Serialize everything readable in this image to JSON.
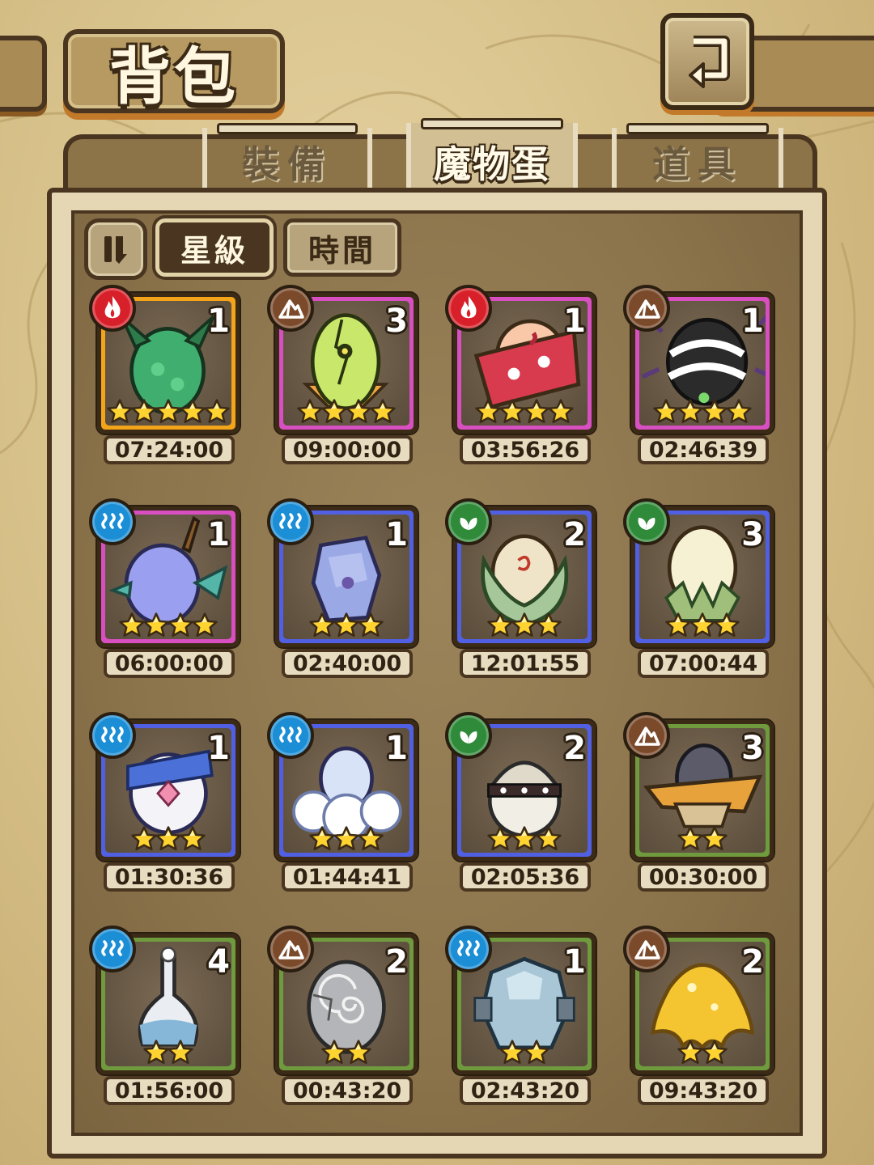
{
  "header": {
    "title": "背包",
    "back_icon": "return-arrow-icon"
  },
  "tabs": [
    {
      "label": "裝備",
      "active": false
    },
    {
      "label": "魔物蛋",
      "active": true
    },
    {
      "label": "道具",
      "active": false
    }
  ],
  "sort": {
    "toggle_icon": "sort-toggle-icon",
    "star_label": "星級",
    "time_label": "時間",
    "active": "星級"
  },
  "colors": {
    "frame_gold": "#f3a418",
    "frame_pink": "#d74fc1",
    "frame_blue": "#5160e3",
    "frame_green": "#6f9a3d",
    "fire": "#d8202a",
    "earth": "#7a4a2b",
    "water": "#1b8ed6",
    "wind": "#2f8a3a"
  },
  "eggs": [
    {
      "element": "fire",
      "element_icon": "fire-element-icon",
      "count": "1",
      "stars": 5,
      "rarity": "gold",
      "timer": "07:24:00",
      "art": "green-dragon-egg"
    },
    {
      "element": "earth",
      "element_icon": "earth-element-icon",
      "count": "3",
      "stars": 4,
      "rarity": "pink",
      "timer": "09:00:00",
      "art": "cracked-eye-egg"
    },
    {
      "element": "fire",
      "element_icon": "fire-element-icon",
      "count": "1",
      "stars": 4,
      "rarity": "pink",
      "timer": "03:56:26",
      "art": "kimono-egg"
    },
    {
      "element": "earth",
      "element_icon": "earth-element-icon",
      "count": "1",
      "stars": 4,
      "rarity": "pink",
      "timer": "02:46:39",
      "art": "spider-egg"
    },
    {
      "element": "water",
      "element_icon": "water-element-icon",
      "count": "1",
      "stars": 4,
      "rarity": "pink",
      "timer": "06:00:00",
      "art": "horned-fin-egg"
    },
    {
      "element": "water",
      "element_icon": "water-element-icon",
      "count": "1",
      "stars": 3,
      "rarity": "blue",
      "timer": "02:40:00",
      "art": "crystal-egg"
    },
    {
      "element": "wind",
      "element_icon": "wind-element-icon",
      "count": "2",
      "stars": 3,
      "rarity": "blue",
      "timer": "12:01:55",
      "art": "leaf-wrapped-egg"
    },
    {
      "element": "wind",
      "element_icon": "wind-element-icon",
      "count": "3",
      "stars": 3,
      "rarity": "blue",
      "timer": "07:00:44",
      "art": "flower-bud-egg"
    },
    {
      "element": "water",
      "element_icon": "water-element-icon",
      "count": "1",
      "stars": 3,
      "rarity": "blue",
      "timer": "01:30:36",
      "art": "sailor-egg"
    },
    {
      "element": "water",
      "element_icon": "water-element-icon",
      "count": "1",
      "stars": 3,
      "rarity": "blue",
      "timer": "01:44:41",
      "art": "cloud-egg"
    },
    {
      "element": "wind",
      "element_icon": "wind-element-icon",
      "count": "2",
      "stars": 3,
      "rarity": "blue",
      "timer": "02:05:36",
      "art": "helmet-egg"
    },
    {
      "element": "earth",
      "element_icon": "earth-element-icon",
      "count": "3",
      "stars": 2,
      "rarity": "green",
      "timer": "00:30:00",
      "art": "hat-egg"
    },
    {
      "element": "water",
      "element_icon": "water-element-icon",
      "count": "4",
      "stars": 2,
      "rarity": "green",
      "timer": "01:56:00",
      "art": "flask-egg"
    },
    {
      "element": "earth",
      "element_icon": "earth-element-icon",
      "count": "2",
      "stars": 2,
      "rarity": "green",
      "timer": "00:43:20",
      "art": "stone-spiral-egg"
    },
    {
      "element": "water",
      "element_icon": "water-element-icon",
      "count": "1",
      "stars": 2,
      "rarity": "green",
      "timer": "02:43:20",
      "art": "ice-rock-egg"
    },
    {
      "element": "earth",
      "element_icon": "earth-element-icon",
      "count": "2",
      "stars": 2,
      "rarity": "green",
      "timer": "09:43:20",
      "art": "golden-slime-egg"
    }
  ]
}
